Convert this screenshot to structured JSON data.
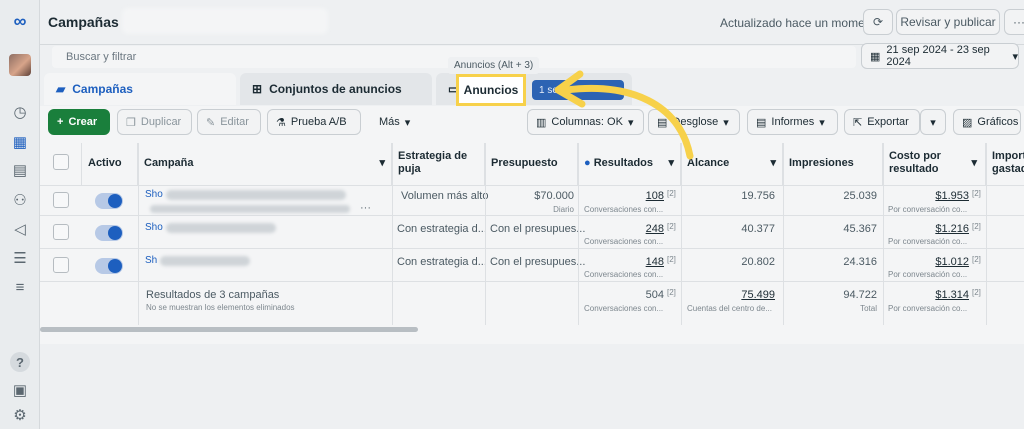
{
  "app": {
    "title": "Campañas",
    "updated": "Actualizado hace un momento"
  },
  "topbar": {
    "review_publish": "Revisar y publicar",
    "more": "···"
  },
  "search": {
    "placeholder": "Buscar y filtrar"
  },
  "date_range": "21 sep 2024 - 23 sep 2024",
  "tabs": {
    "campaigns": "Campañas",
    "ad_sets": "Conjuntos de anuncios",
    "ads": "Anuncios",
    "ads_tooltip": "Anuncios (Alt + 3)",
    "selected_pill": "1 se"
  },
  "toolbar": {
    "create": "Crear",
    "duplicate": "Duplicar",
    "edit": "Editar",
    "ab_test": "Prueba A/B",
    "more": "Más",
    "columns": "Columnas: OK",
    "breakdown": "Desglose",
    "reports": "Informes",
    "export": "Exportar",
    "charts": "Gráficos"
  },
  "table": {
    "headers": {
      "active": "Activo",
      "campaign": "Campaña",
      "bid_strategy": "Estrategia de puja",
      "budget": "Presupuesto",
      "results": "Resultados",
      "reach": "Alcance",
      "impressions": "Impresiones",
      "cost_per_result": "Costo por resultado",
      "amount_spent": "Import gastad"
    },
    "rows": [
      {
        "name": "Sho",
        "bid": "Volumen más alto",
        "budget": "$70.000",
        "budget_sub": "Diario",
        "results": "108",
        "results_sub": "Conversaciones con...",
        "reach": "19.756",
        "impressions": "25.039",
        "cost": "$1.953",
        "cost_sub": "Por conversación co..."
      },
      {
        "name": "Sho",
        "bid": "Con estrategia d...",
        "budget": "Con el presupues...",
        "budget_sub": "",
        "results": "248",
        "results_sub": "Conversaciones con...",
        "reach": "40.377",
        "impressions": "45.367",
        "cost": "$1.216",
        "cost_sub": "Por conversación co..."
      },
      {
        "name": "Sh",
        "bid": "Con estrategia d...",
        "budget": "Con el presupues...",
        "budget_sub": "",
        "results": "148",
        "results_sub": "Conversaciones con...",
        "reach": "20.802",
        "impressions": "24.316",
        "cost": "$1.012",
        "cost_sub": "Por conversación co..."
      }
    ],
    "footnote_mark": "[2]",
    "total": {
      "label": "Resultados de 3 campañas",
      "sub": "No se muestran los elementos eliminados",
      "results": "504",
      "results_sub": "Conversaciones con...",
      "reach": "75.499",
      "reach_sub": "Cuentas del centro de...",
      "impressions": "94.722",
      "impressions_sub": "Total",
      "cost": "$1.314",
      "cost_sub": "Por conversación co..."
    }
  },
  "colors": {
    "accent": "#1d5fbf",
    "create": "#1a7f3c",
    "highlight": "#f7d14a"
  }
}
